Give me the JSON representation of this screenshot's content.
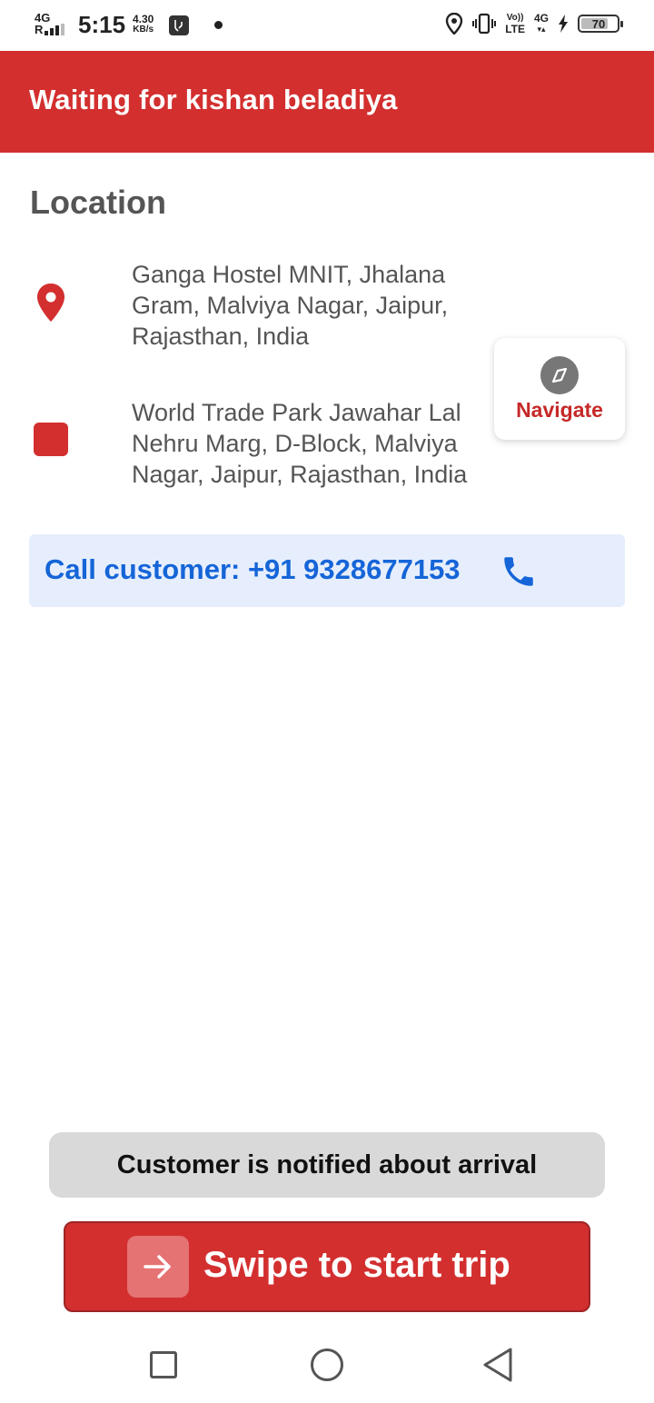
{
  "status_bar": {
    "network": "4G",
    "signal_prefix": "R",
    "time": "5:15",
    "speed_value": "4.30",
    "speed_unit": "KB/s",
    "volte_top": "Vo))",
    "volte_bottom": "LTE",
    "network_right": "4G",
    "battery": "70",
    "icons": [
      "usb-debug-icon",
      "location-icon",
      "vibrate-icon",
      "charging-icon"
    ]
  },
  "header": {
    "title": "Waiting for kishan beladiya",
    "color": "#d32f2f"
  },
  "location": {
    "title": "Location",
    "pickup": {
      "icon": "map-pin-icon",
      "address": "Ganga Hostel MNIT, Jhalana Gram, Malviya Nagar, Jaipur, Rajasthan, India"
    },
    "drop": {
      "icon": "square-stop-icon",
      "address": "World Trade Park Jawahar Lal Nehru Marg, D-Block, Malviya Nagar, Jaipur, Rajasthan, India"
    }
  },
  "navigate": {
    "icon": "compass-icon",
    "label": "Navigate"
  },
  "call": {
    "label": "Call customer: +91 9328677153",
    "icon": "phone-icon"
  },
  "notification": {
    "text": "Customer is notified about arrival"
  },
  "swipe": {
    "label": "Swipe to start trip",
    "icon": "arrow-right-icon"
  },
  "nav_bar": {
    "icons": [
      "recents-icon",
      "home-icon",
      "back-icon"
    ]
  }
}
